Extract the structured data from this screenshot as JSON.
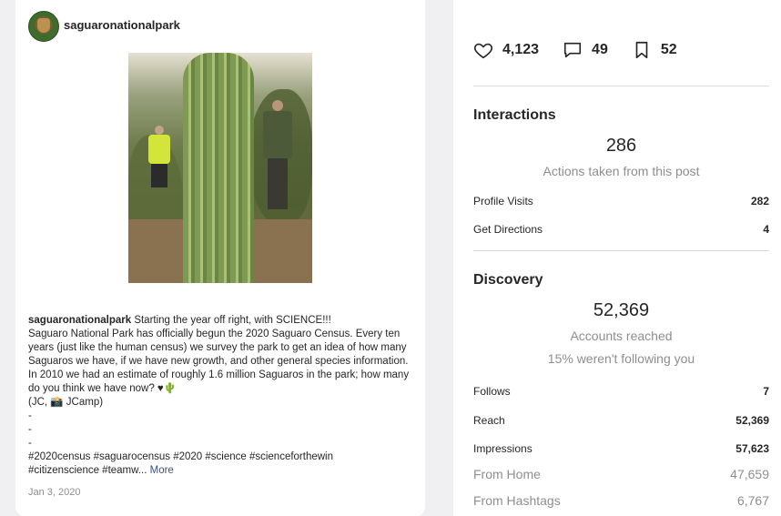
{
  "post": {
    "username": "saguaronationalpark",
    "caption_user": "saguaronationalpark",
    "caption_text": " Starting the year off right, with SCIENCE!!!\nSaguaro National Park has officially begun the 2020 Saguaro Census. Every ten years (just like the human census) we survey the park to get an idea of how many Saguaros we have, if we have new growth, and other general species information. In 2010 we had an estimate of roughly 1.6 million Saguaros in the park; how many do you think we have now? ♥🌵\n(JC, 📸 JCamp)\n-\n-\n-\n#2020census #saguarocensus #2020 #science #scienceforthewin\n#citizenscience #teamw...",
    "more_label": "More",
    "date": "Jan 3, 2020"
  },
  "stats": {
    "likes": "4,123",
    "comments": "49",
    "saves": "52"
  },
  "interactions": {
    "title": "Interactions",
    "total": "286",
    "total_label": "Actions taken from this post",
    "rows": [
      {
        "label": "Profile Visits",
        "value": "282"
      },
      {
        "label": "Get Directions",
        "value": "4"
      }
    ]
  },
  "discovery": {
    "title": "Discovery",
    "total": "52,369",
    "total_label": "Accounts reached",
    "following_note": "15% weren't following you",
    "rows": [
      {
        "label": "Follows",
        "value": "7"
      },
      {
        "label": "Reach",
        "value": "52,369"
      },
      {
        "label": "Impressions",
        "value": "57,623"
      }
    ],
    "sources": [
      {
        "label": "From Home",
        "value": "47,659"
      },
      {
        "label": "From Hashtags",
        "value": "6,767"
      }
    ]
  },
  "icons": [
    "heart-icon",
    "comment-icon",
    "bookmark-icon"
  ]
}
